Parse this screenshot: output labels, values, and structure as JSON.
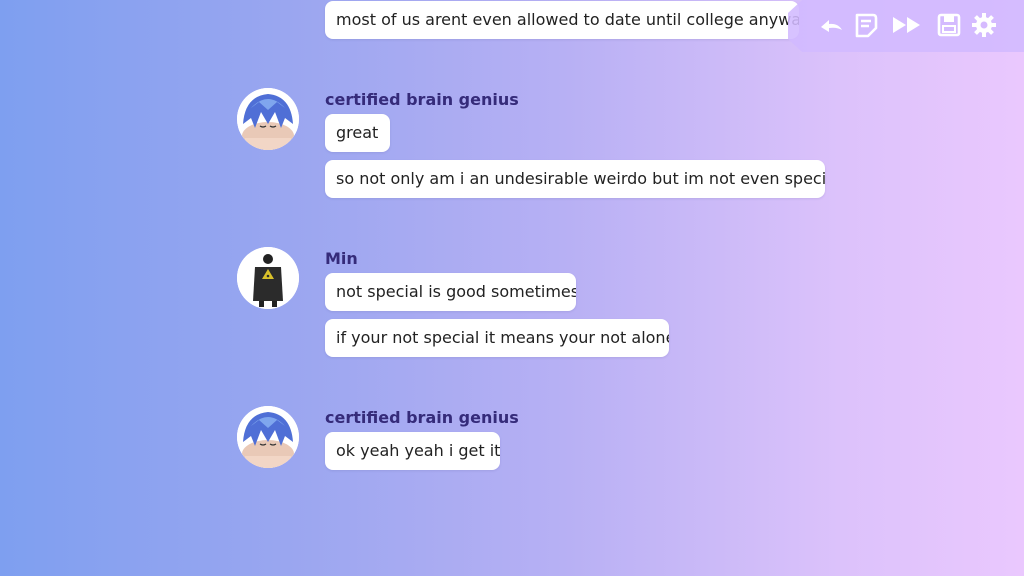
{
  "colors": {
    "bubble": "#ffffff",
    "name": "#352b7a",
    "toolbar_icon": "#ffffff"
  },
  "toolbar": {
    "icons": [
      "back-icon",
      "log-icon",
      "fast-forward-icon",
      "save-icon",
      "settings-icon"
    ]
  },
  "messages": [
    {
      "text": "most of us arent even allowed to date until college anyways"
    },
    {
      "sender": "certified brain genius",
      "avatar": "blue-hair-avatar",
      "lines": [
        "great",
        "so not only am i an undesirable weirdo but im not even special"
      ]
    },
    {
      "sender": "Min",
      "avatar": "dark-figure-avatar",
      "lines": [
        "not special is good sometimes",
        "if your not special it means your not alone"
      ]
    },
    {
      "sender": "certified brain genius",
      "avatar": "blue-hair-avatar",
      "lines": [
        "ok yeah yeah i get it"
      ]
    }
  ]
}
